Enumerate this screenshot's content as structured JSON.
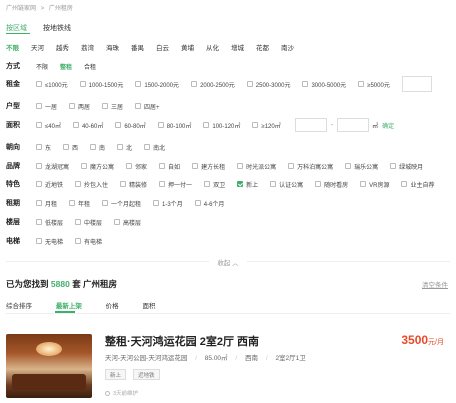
{
  "breadcrumb": [
    "广州链家网",
    ">",
    "广州租房"
  ],
  "tabs": [
    {
      "label": "按区域",
      "active": true
    },
    {
      "label": "按地铁线",
      "active": false
    }
  ],
  "districts": [
    {
      "label": "不限",
      "active": true
    },
    {
      "label": "天河"
    },
    {
      "label": "越秀"
    },
    {
      "label": "荔湾"
    },
    {
      "label": "海珠"
    },
    {
      "label": "番禺"
    },
    {
      "label": "白云"
    },
    {
      "label": "黄埔"
    },
    {
      "label": "从化"
    },
    {
      "label": "增城"
    },
    {
      "label": "花都"
    },
    {
      "label": "南沙"
    }
  ],
  "filters": {
    "mode": {
      "label": "方式",
      "options": [
        "不限",
        "整租",
        "合租"
      ],
      "active": "整租"
    },
    "rent": {
      "label": "租金",
      "options": [
        "≤1000元",
        "1000-1500元",
        "1500-2000元",
        "2000-2500元",
        "2500-3000元",
        "3000-5000元",
        "≥5000元"
      ]
    },
    "layout": {
      "label": "户型",
      "options": [
        "一居",
        "两居",
        "三居",
        "四居+"
      ]
    },
    "area": {
      "label": "面积",
      "options": [
        "≤40㎡",
        "40-60㎡",
        "60-80㎡",
        "80-100㎡",
        "100-120㎡",
        "≥120㎡"
      ],
      "unit": "㎡",
      "dash": "-",
      "confirm": "确定"
    },
    "orientation": {
      "label": "朝向",
      "options": [
        "东",
        "西",
        "南",
        "北",
        "南北"
      ]
    },
    "brand": {
      "label": "品牌",
      "options": [
        "龙湖冠寓",
        "魔方公寓",
        "邻家",
        "自如",
        "建方长租",
        "时光派公寓",
        "万科泊寓公寓",
        "瑞乐公寓",
        "绿城映月"
      ]
    },
    "feature": {
      "label": "特色",
      "options": [
        "近地铁",
        "拎包入住",
        "精装修",
        "押一付一",
        "双卫",
        "新上",
        "认证公寓",
        "随时看房",
        "VR房源",
        "业主自荐"
      ],
      "checked": "新上"
    },
    "term": {
      "label": "租期",
      "options": [
        "月租",
        "年租",
        "一个月起租",
        "1-3个月",
        "4-6个月"
      ]
    },
    "floor": {
      "label": "楼层",
      "options": [
        "低楼层",
        "中楼层",
        "高楼层"
      ]
    },
    "elevator": {
      "label": "电梯",
      "options": [
        "无电梯",
        "有电梯"
      ]
    }
  },
  "collapse_label": "收起 ︿",
  "result": {
    "prefix": "已为您找到",
    "count": "5880",
    "suffix": "套 广州租房",
    "clear_label": "清空条件"
  },
  "sort_tabs": [
    {
      "label": "综合排序"
    },
    {
      "label": "最新上架",
      "active": true
    },
    {
      "label": "价格"
    },
    {
      "label": "面积"
    }
  ],
  "listing": {
    "title": "整租·天河鸿运花园 2室2厅 西南",
    "price": "3500",
    "price_unit": "元/月",
    "addr_parts": [
      "天河-天河公园-天河鸿运花园",
      "/",
      "85.00㎡",
      "/",
      "西南",
      "/",
      "2室2厅1卫"
    ],
    "tags": [
      "新上",
      "近地铁"
    ],
    "maintenance": "3天前维护"
  },
  "colors": {
    "accent": "#3fb06a",
    "price": "#e84a2a"
  }
}
